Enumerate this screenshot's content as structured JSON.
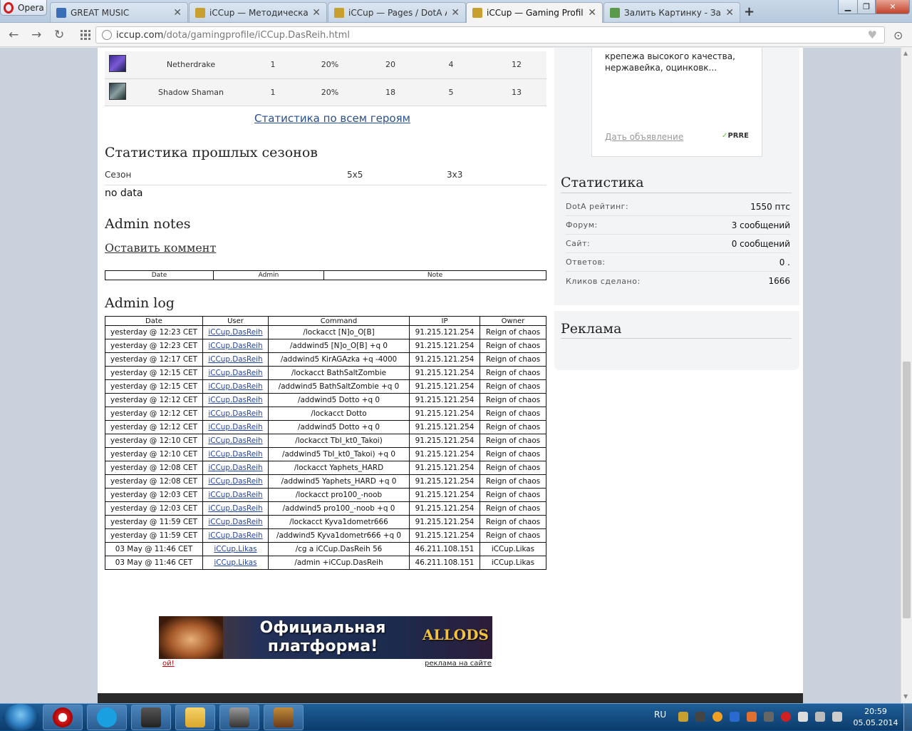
{
  "browser": {
    "menu_label": "Opera",
    "tabs": [
      {
        "title": "GREAT MUSIC",
        "active": false
      },
      {
        "title": "iCCup — Методическая и",
        "active": false
      },
      {
        "title": "iCCup — Pages / DotA Ad",
        "active": false
      },
      {
        "title": "iCCup — Gaming Profile /",
        "active": true
      },
      {
        "title": "Залить Картинку - Загру",
        "active": false
      }
    ],
    "new_tab": "+",
    "address_domain": "iccup.com",
    "address_path": "/dota/gamingprofile/iCCup.DasReih.html"
  },
  "heroes": [
    {
      "name": "Netherdrake",
      "c1": "1",
      "c2": "20%",
      "c3": "20",
      "c4": "4",
      "c5": "12",
      "icon": "netherdrake-icon"
    },
    {
      "name": "Shadow Shaman",
      "c1": "1",
      "c2": "20%",
      "c3": "18",
      "c4": "5",
      "c5": "13",
      "icon": "shadow-shaman-icon"
    }
  ],
  "all_heroes_link": "Статистика по всем героям",
  "past_seasons": {
    "title": "Статистика прошлых сезонов",
    "col_season": "Сезон",
    "col_5x5": "5x5",
    "col_3x3": "3x3",
    "empty": "no data"
  },
  "admin_notes": {
    "title": "Admin notes",
    "leave_comment": "Оставить коммент",
    "headers": [
      "Date",
      "Admin",
      "Note"
    ]
  },
  "admin_log": {
    "title": "Admin log",
    "headers": [
      "Date",
      "User",
      "Command",
      "IP",
      "Owner"
    ],
    "rows": [
      [
        "yesterday @ 12:23 CET",
        "iCCup.DasReih",
        "/lockacct [N]o_O[B]",
        "91.215.121.254",
        "Reign of chaos"
      ],
      [
        "yesterday @ 12:23 CET",
        "iCCup.DasReih",
        "/addwind5 [N]o_O[B] +q 0",
        "91.215.121.254",
        "Reign of chaos"
      ],
      [
        "yesterday @ 12:17 CET",
        "iCCup.DasReih",
        "/addwind5 KirAGAzka +q -4000",
        "91.215.121.254",
        "Reign of chaos"
      ],
      [
        "yesterday @ 12:15 CET",
        "iCCup.DasReih",
        "/lockacct BathSaltZombie",
        "91.215.121.254",
        "Reign of chaos"
      ],
      [
        "yesterday @ 12:15 CET",
        "iCCup.DasReih",
        "/addwind5 BathSaltZombie +q 0",
        "91.215.121.254",
        "Reign of chaos"
      ],
      [
        "yesterday @ 12:12 CET",
        "iCCup.DasReih",
        "/addwind5 Dotto +q 0",
        "91.215.121.254",
        "Reign of chaos"
      ],
      [
        "yesterday @ 12:12 CET",
        "iCCup.DasReih",
        "/lockacct Dotto",
        "91.215.121.254",
        "Reign of chaos"
      ],
      [
        "yesterday @ 12:12 CET",
        "iCCup.DasReih",
        "/addwind5 Dotto +q 0",
        "91.215.121.254",
        "Reign of chaos"
      ],
      [
        "yesterday @ 12:10 CET",
        "iCCup.DasReih",
        "/lockacct TbI_kt0_Takoi)",
        "91.215.121.254",
        "Reign of chaos"
      ],
      [
        "yesterday @ 12:10 CET",
        "iCCup.DasReih",
        "/addwind5 TbI_kt0_Takoi) +q 0",
        "91.215.121.254",
        "Reign of chaos"
      ],
      [
        "yesterday @ 12:08 CET",
        "iCCup.DasReih",
        "/lockacct Yaphets_HARD",
        "91.215.121.254",
        "Reign of chaos"
      ],
      [
        "yesterday @ 12:08 CET",
        "iCCup.DasReih",
        "/addwind5 Yaphets_HARD +q 0",
        "91.215.121.254",
        "Reign of chaos"
      ],
      [
        "yesterday @ 12:03 CET",
        "iCCup.DasReih",
        "/lockacct pro100_-noob",
        "91.215.121.254",
        "Reign of chaos"
      ],
      [
        "yesterday @ 12:03 CET",
        "iCCup.DasReih",
        "/addwind5 pro100_-noob +q 0",
        "91.215.121.254",
        "Reign of chaos"
      ],
      [
        "yesterday @ 11:59 CET",
        "iCCup.DasReih",
        "/lockacct Kyva1dometr666",
        "91.215.121.254",
        "Reign of chaos"
      ],
      [
        "yesterday @ 11:59 CET",
        "iCCup.DasReih",
        "/addwind5 Kyva1dometr666 +q 0",
        "91.215.121.254",
        "Reign of chaos"
      ],
      [
        "03 May @ 11:46 CET",
        "iCCup.Likas",
        "/cg a iCCup.DasReih 56",
        "46.211.108.151",
        "iCCup.Likas"
      ],
      [
        "03 May @ 11:46 CET",
        "iCCup.Likas",
        "/admin +iCCup.DasReih",
        "46.211.108.151",
        "iCCup.Likas"
      ]
    ]
  },
  "banner": {
    "headline": "Официальная платформа!",
    "logo_text": "ALLODS",
    "left_link": "ой!",
    "right_link": "реклама на сайте"
  },
  "sidebar": {
    "ad_text": "крепежа высокого качества, нержавейка, оцинковк...",
    "ad_link": "Дать объявление",
    "ad_brand": "PRRE",
    "stats_title": "Статистика",
    "stats": [
      {
        "key": "DotA рейтинг:",
        "value": "1550 птс"
      },
      {
        "key": "Форум:",
        "value": "3 сообщений"
      },
      {
        "key": "Сайт:",
        "value": "0 сообщений"
      },
      {
        "key": "Ответов:",
        "value": "0 ."
      },
      {
        "key": "Кликов сделано:",
        "value": "1666"
      }
    ],
    "ads_title": "Реклама"
  },
  "taskbar": {
    "lang": "RU",
    "time": "20:59",
    "date": "05.05.2014"
  },
  "colors": {
    "link": "#2a4f8f",
    "taskbar": "#1b5590",
    "opera_red": "#d21d1d"
  }
}
